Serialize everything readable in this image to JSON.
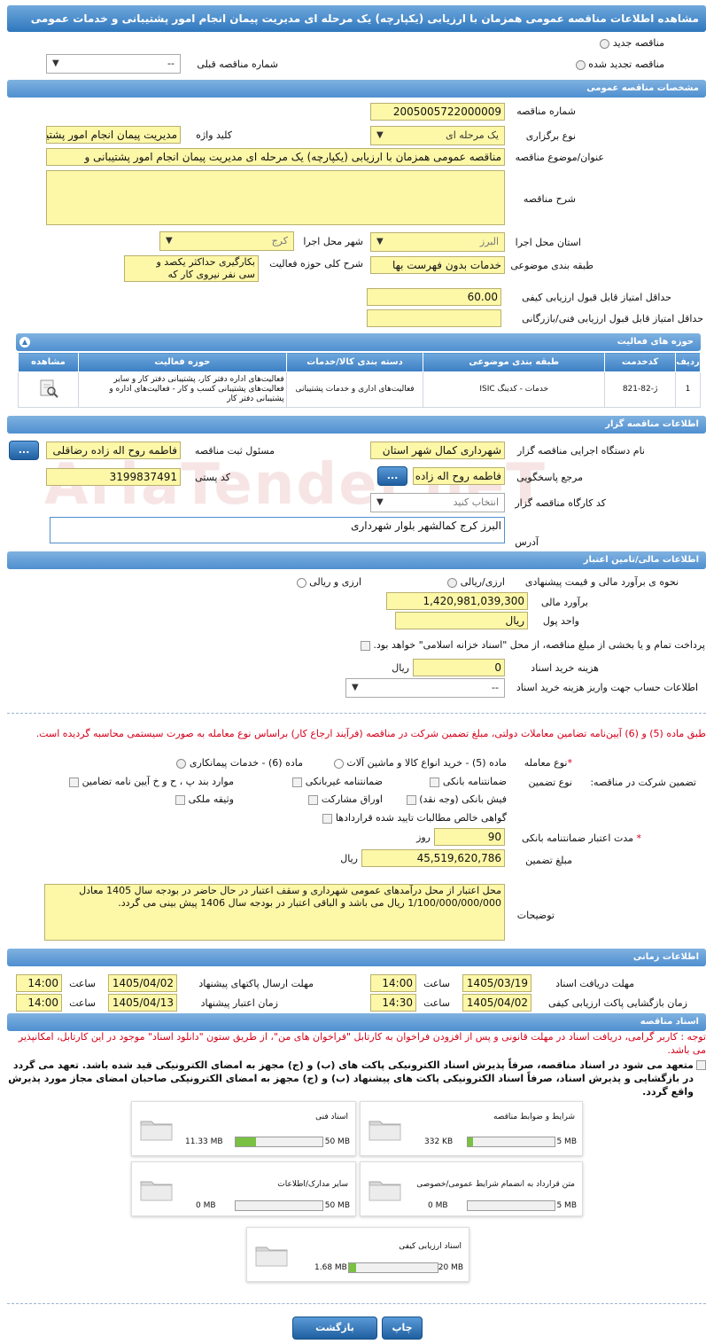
{
  "title": "مشاهده اطلاعات مناقصه عمومی همزمان با ارزیابی (یکپارچه) یک مرحله ای مدیریت پیمان انجام امور پشتیبانی و خدمات عمومی",
  "top": {
    "new": "مناقصه جدید",
    "renewed": "مناقصه تجدید شده",
    "prev_label": "شماره مناقصه قبلی",
    "prev_value": "--"
  },
  "general": {
    "header": "مشخصات مناقصه عمومی",
    "number_label": "شماره مناقصه",
    "number": "2005005722000009",
    "type_label": "نوع برگزاری",
    "type": "یک مرحله ای",
    "keyword_label": "کلید واژه",
    "keyword": "مدیریت پیمان انجام امور پشتیبانی",
    "subject_label": "عنوان/موضوع مناقصه",
    "subject": "مناقصه عمومی همزمان با ارزیابی (یکپارچه) یک مرحله ای مدیریت پیمان انجام امور پشتیبانی و",
    "desc_label": "شرح مناقصه",
    "province_label": "استان محل اجرا",
    "province": "البرز",
    "city_label": "شهر محل اجرا",
    "city": "کرج",
    "category_label": "طبقه بندی موضوعی",
    "category": "خدمات بدون فهرست بها",
    "scope_label": "شرح کلی حوزه فعالیت",
    "scope": "بکارگیری حداکثر یکصد و سی نفر نیروی کار که",
    "min_quality_label": "حداقل امتیاز قابل قبول ارزیابی کیفی",
    "min_quality": "60.00",
    "min_tech_label": "حداقل امتیاز قابل قبول ارزیابی فنی/بازرگانی"
  },
  "activities": {
    "header": "حوزه های فعالیت",
    "columns": [
      "ردیف",
      "کدخدمت",
      "طبقه بندی موضوعی",
      "دسته بندی کالا/خدمات",
      "حوزه فعالیت",
      "مشاهده"
    ],
    "rows": [
      {
        "row": "1",
        "code": "ژ-82-821",
        "cat": "خدمات - کدینگ ISIC",
        "group": "فعالیت‌های اداری و خدمات پشتیبانی",
        "field": "فعالیت‌های اداره دفتر کار، پشتیبانی دفتر کار و سایر فعالیت‌های پشتیبانی کسب و کار - فعالیت‌های اداره و پشتیبانی دفتر کار"
      }
    ]
  },
  "organizer": {
    "header": "اطلاعات مناقصه گزار",
    "org_label": "نام دستگاه اجرایی مناقصه گزار",
    "org": "شهرداری کمال شهر استان",
    "resp_label": "مسئول ثبت مناقصه",
    "resp": "فاطمه روح اله زاده رضاقلی",
    "ref_label": "مرجع پاسخگویی",
    "ref": "فاطمه روح اله زاده",
    "postal_label": "کد پستی",
    "postal": "3199837491",
    "workshop_label": "کد کارگاه مناقصه گزار",
    "workshop": "انتخاب کنید",
    "address_label": "آدرس",
    "address": "البرز کرج کمالشهر بلوار شهرداری",
    "more": "..."
  },
  "finance": {
    "header": "اطلاعات مالی/تامین اعتبار",
    "method_label": "نحوه ی برآورد مالی و قیمت پیشنهادی",
    "opt1": "ارزی/ریالی",
    "opt2": "ارزی و ریالی",
    "estimate_label": "برآورد مالی",
    "estimate": "1,420,981,039,300",
    "unit_label": "واحد پول",
    "unit": "ریال",
    "treasury": "پرداخت تمام و یا بخشی از مبلغ مناقصه، از محل \"اسناد خزانه اسلامی\" خواهد بود.",
    "doc_cost_label": "هزینه خرید اسناد",
    "doc_cost": "0",
    "doc_cost_unit": "ریال",
    "account_label": "اطلاعات حساب جهت واریز هزینه خرید اسناد",
    "account": "--"
  },
  "guarantee": {
    "notice": "طبق ماده (5) و (6) آیین‌نامه تضامین معاملات دولتی، مبلغ تضمین شرکت در مناقصه (فرآیند ارجاع کار) براساس نوع معامله به صورت سیستمی محاسبه گردیده است.",
    "deal_label": "نوع معامله",
    "deal1": "ماده (5) - خرید انواع کالا و ماشین آلات",
    "deal2": "ماده (6) - خدمات پیمانکاری",
    "g_label": "تضمین شرکت در مناقصه:",
    "g_type": "نوع تضمین",
    "bank": "ضمانتنامه بانکی",
    "nonbank": "ضمانتنامه غیربانکی",
    "clauses": "موارد بند پ ، ح و خ آیین نامه تضامین",
    "cash": "فیش بانکی (وجه نقد)",
    "bonds": "اوراق مشارکت",
    "property": "وثیقه ملکی",
    "claims": "گواهی خالص مطالبات تایید شده قراردادها",
    "validity_label": "مدت اعتبار ضمانتنامه بانکی",
    "validity": "90",
    "validity_unit": "روز",
    "amount_label": "مبلغ تضمین",
    "amount": "45,519,620,786",
    "amount_unit": "ریال",
    "notes_label": "توضیحات",
    "notes": "محل اعتبار از محل درآمدهای عمومی شهرداری و سقف اعتبار در حال حاضر در بودجه سال 1405 معادل 1/100/000/000/000 ریال می باشد و الباقی اعتبار در بودجه سال 1406 پیش بینی می گردد."
  },
  "timing": {
    "header": "اطلاعات زمانی",
    "doc_recv_label": "مهلت دریافت اسناد",
    "doc_recv_date": "1405/03/19",
    "doc_recv_time": "14:00",
    "send_label": "مهلت ارسال پاکتهای پیشنهاد",
    "send_date": "1405/04/02",
    "send_time": "14:00",
    "open_label": "زمان بازگشایی پاکت ارزیابی کیفی",
    "open_date": "1405/04/02",
    "open_time": "14:30",
    "valid_label": "زمان اعتبار پیشنهاد",
    "valid_date": "1405/04/13",
    "valid_time": "14:00",
    "hour": "ساعت"
  },
  "documents": {
    "header": "اسناد مناقصه",
    "notice": "توجه : کاربر گرامی، دریافت اسناد در مهلت قانونی و پس از افزودن فراخوان به کارتابل \"فراخوان های من\"، از طریق ستون \"دانلود اسناد\" موجود در این کارتابل، امکانپذیر می باشد.",
    "commit": "متعهد می شود در اسناد مناقصه، صرفاً پذیرش اسناد الکترونیکی پاکت های (ب) و (ج) مجهز به امضای الکترونیکی قید شده باشد. تعهد می گردد در بازگشایی و پذیرش اسناد، صرفاً اسناد الکترونیکی پاکت های پیشنهاد (ب) و (ج) مجهز به امضای الکترونیکی صاحبان امضای مجاز مورد پذیرش واقع گردد.",
    "files": [
      {
        "name": "شرایط و ضوابط مناقصه",
        "size": "332 KB",
        "max": "5 MB",
        "pct": 6
      },
      {
        "name": "اسناد فنی",
        "size": "11.33 MB",
        "max": "50 MB",
        "pct": 23
      },
      {
        "name": "متن قرارداد به انضمام شرایط عمومی/خصوصی",
        "size": "0 MB",
        "max": "5 MB",
        "pct": 0
      },
      {
        "name": "سایر مدارک/اطلاعات",
        "size": "0 MB",
        "max": "50 MB",
        "pct": 0
      },
      {
        "name": "اسناد ارزیابی کیفی",
        "size": "1.68 MB",
        "max": "20 MB",
        "pct": 8
      }
    ]
  },
  "actions": {
    "print": "چاپ",
    "back": "بازگشت"
  }
}
